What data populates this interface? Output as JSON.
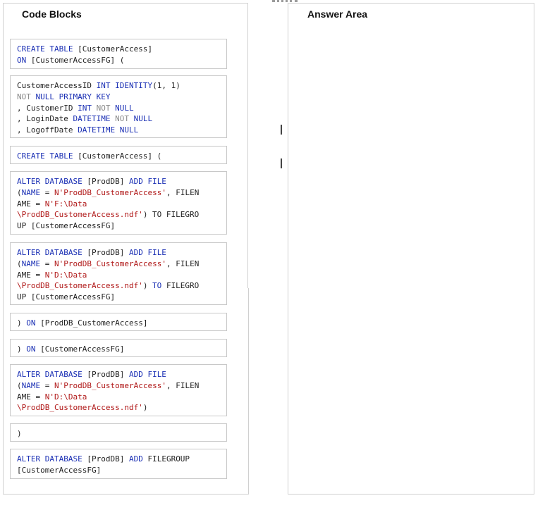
{
  "code_blocks_panel": {
    "title": "Code Blocks"
  },
  "answer_area_panel": {
    "title": "Answer Area"
  },
  "blocks": [
    {
      "id": "create-table-on-fg",
      "lines": [
        [
          {
            "t": "CREATE TABLE ",
            "c": "kw"
          },
          {
            "t": "[CustomerAccess]",
            "c": "pl"
          }
        ],
        [
          {
            "t": "ON ",
            "c": "kw"
          },
          {
            "t": "[CustomerAccessFG] (",
            "c": "pl"
          }
        ]
      ]
    },
    {
      "id": "columns-definition",
      "lines": [
        [
          {
            "t": "CustomerAccessID ",
            "c": "pl"
          },
          {
            "t": "INT ",
            "c": "kw"
          },
          {
            "t": "IDENTITY",
            "c": "kw"
          },
          {
            "t": "(1, 1)",
            "c": "pl"
          }
        ],
        [
          {
            "t": "NOT ",
            "c": "gr"
          },
          {
            "t": "NULL ",
            "c": "kw"
          },
          {
            "t": "PRIMARY KEY",
            "c": "kw"
          }
        ],
        [
          {
            "t": ", CustomerID ",
            "c": "pl"
          },
          {
            "t": "INT ",
            "c": "kw"
          },
          {
            "t": "NOT ",
            "c": "gr"
          },
          {
            "t": "NULL",
            "c": "kw"
          }
        ],
        [
          {
            "t": ", LoginDate ",
            "c": "pl"
          },
          {
            "t": "DATETIME ",
            "c": "kw"
          },
          {
            "t": "NOT ",
            "c": "gr"
          },
          {
            "t": "NULL",
            "c": "kw"
          }
        ],
        [
          {
            "t": ", LogoffDate ",
            "c": "pl"
          },
          {
            "t": "DATETIME ",
            "c": "kw"
          },
          {
            "t": "NULL",
            "c": "kw"
          }
        ]
      ]
    },
    {
      "id": "create-table",
      "lines": [
        [
          {
            "t": "CREATE TABLE ",
            "c": "kw"
          },
          {
            "t": "[CustomerAccess] (",
            "c": "pl"
          }
        ]
      ]
    },
    {
      "id": "alter-db-add-file-f-to-fg",
      "lines": [
        [
          {
            "t": "ALTER DATABASE ",
            "c": "kw"
          },
          {
            "t": "[ProdDB] ",
            "c": "pl"
          },
          {
            "t": "ADD FILE",
            "c": "kw"
          }
        ],
        [
          {
            "t": "(",
            "c": "pl"
          },
          {
            "t": "NAME ",
            "c": "kw"
          },
          {
            "t": "= ",
            "c": "pl"
          },
          {
            "t": "N'ProdDB_CustomerAccess'",
            "c": "st"
          },
          {
            "t": ", FILEN",
            "c": "pl"
          }
        ],
        [
          {
            "t": "AME = ",
            "c": "pl"
          },
          {
            "t": "N'F:\\Data",
            "c": "st"
          }
        ],
        [
          {
            "t": "\\ProdDB_CustomerAccess.ndf'",
            "c": "st"
          },
          {
            "t": ") TO FILEGRO",
            "c": "pl"
          }
        ],
        [
          {
            "t": "UP [CustomerAccessFG]",
            "c": "pl"
          }
        ]
      ]
    },
    {
      "id": "alter-db-add-file-d-to-fg",
      "lines": [
        [
          {
            "t": "ALTER DATABASE ",
            "c": "kw"
          },
          {
            "t": "[ProdDB] ",
            "c": "pl"
          },
          {
            "t": "ADD FILE",
            "c": "kw"
          }
        ],
        [
          {
            "t": "(",
            "c": "pl"
          },
          {
            "t": "NAME ",
            "c": "kw"
          },
          {
            "t": "= ",
            "c": "pl"
          },
          {
            "t": "N'ProdDB_CustomerAccess'",
            "c": "st"
          },
          {
            "t": ", FILEN",
            "c": "pl"
          }
        ],
        [
          {
            "t": "AME = ",
            "c": "pl"
          },
          {
            "t": "N'D:\\Data",
            "c": "st"
          }
        ],
        [
          {
            "t": "\\ProdDB_CustomerAccess.ndf'",
            "c": "st"
          },
          {
            "t": ") ",
            "c": "pl"
          },
          {
            "t": "TO ",
            "c": "kw"
          },
          {
            "t": "FILEGRO",
            "c": "pl"
          }
        ],
        [
          {
            "t": "UP [CustomerAccessFG]",
            "c": "pl"
          }
        ]
      ]
    },
    {
      "id": "on-proddb-customeraccess",
      "lines": [
        [
          {
            "t": ") ",
            "c": "pl"
          },
          {
            "t": "ON ",
            "c": "kw"
          },
          {
            "t": "[ProdDB_CustomerAccess]",
            "c": "pl"
          }
        ]
      ]
    },
    {
      "id": "on-customeraccessfg",
      "lines": [
        [
          {
            "t": ") ",
            "c": "pl"
          },
          {
            "t": "ON ",
            "c": "kw"
          },
          {
            "t": "[CustomerAccessFG]",
            "c": "pl"
          }
        ]
      ]
    },
    {
      "id": "alter-db-add-file-d",
      "lines": [
        [
          {
            "t": "ALTER DATABASE ",
            "c": "kw"
          },
          {
            "t": "[ProdDB] ",
            "c": "pl"
          },
          {
            "t": "ADD FILE",
            "c": "kw"
          }
        ],
        [
          {
            "t": "(",
            "c": "pl"
          },
          {
            "t": "NAME ",
            "c": "kw"
          },
          {
            "t": "= ",
            "c": "pl"
          },
          {
            "t": "N'ProdDB_CustomerAccess'",
            "c": "st"
          },
          {
            "t": ", FILEN",
            "c": "pl"
          }
        ],
        [
          {
            "t": "AME = ",
            "c": "pl"
          },
          {
            "t": "N'D:\\Data",
            "c": "st"
          }
        ],
        [
          {
            "t": "\\ProdDB_CustomerAccess.ndf'",
            "c": "st"
          },
          {
            "t": ")",
            "c": "pl"
          }
        ]
      ]
    },
    {
      "id": "close-paren",
      "lines": [
        [
          {
            "t": ")",
            "c": "pl"
          }
        ]
      ]
    },
    {
      "id": "alter-db-add-filegroup",
      "lines": [
        [
          {
            "t": "ALTER DATABASE ",
            "c": "kw"
          },
          {
            "t": "[ProdDB] ",
            "c": "pl"
          },
          {
            "t": "ADD ",
            "c": "kw"
          },
          {
            "t": "FILEGROUP",
            "c": "pl"
          }
        ],
        [
          {
            "t": "[CustomerAccessFG]",
            "c": "pl"
          }
        ]
      ]
    }
  ],
  "colors": {
    "keyword": "#1a2fb4",
    "not_keyword": "#8a8a8a",
    "string": "#b01818",
    "plain": "#222222"
  }
}
